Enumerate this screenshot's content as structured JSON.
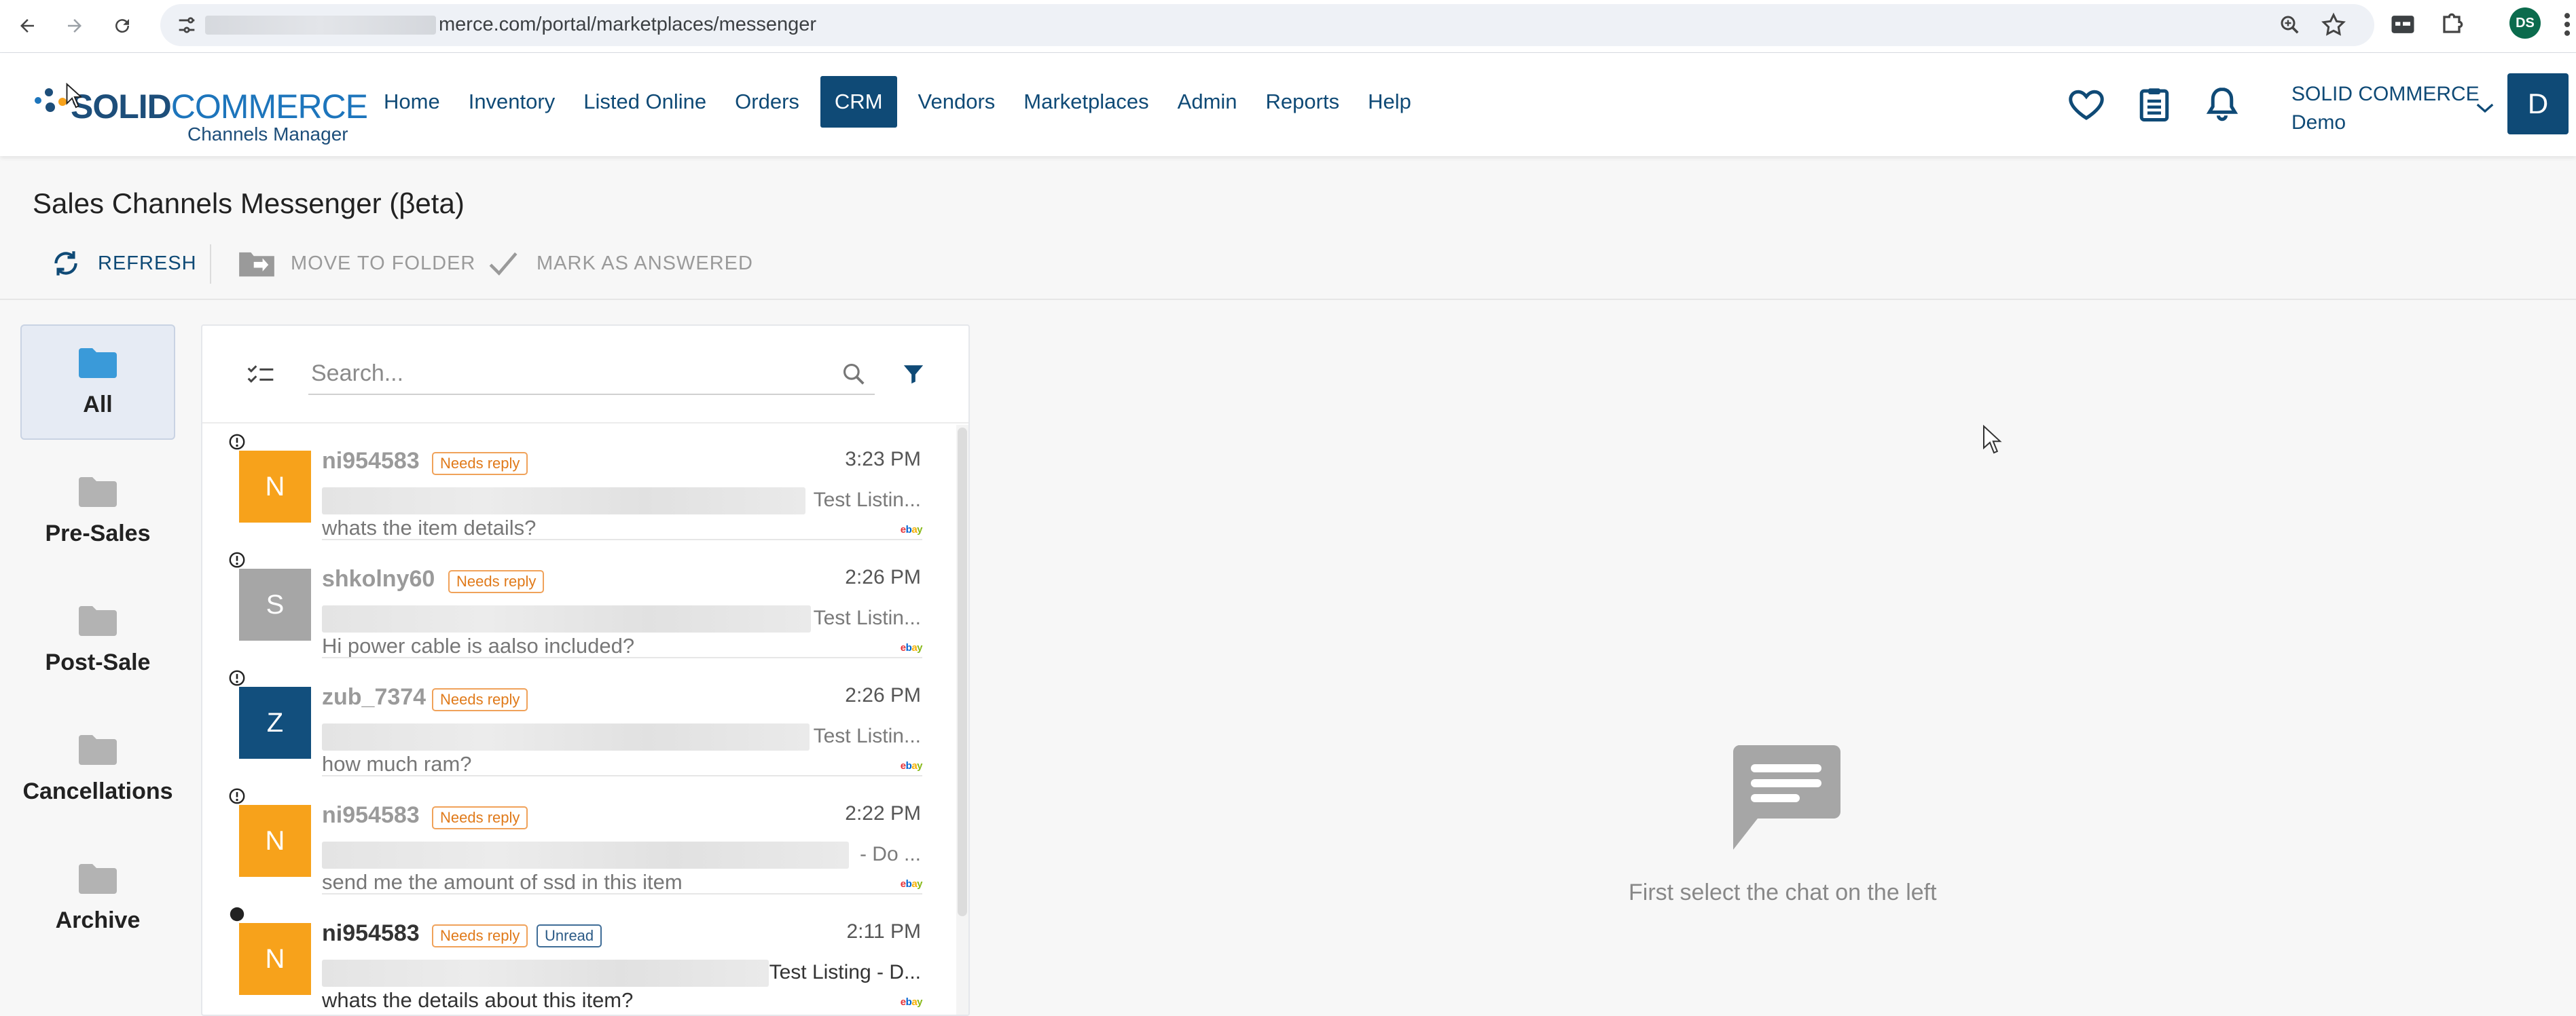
{
  "browser": {
    "url_visible": "merce.com/portal/marketplaces/messenger",
    "profile_initials": "DS"
  },
  "header": {
    "logo": {
      "brand_bold": "SOLID",
      "brand_light": "COMMERCE",
      "subtitle": "Channels Manager"
    },
    "nav": [
      "Home",
      "Inventory",
      "Listed Online",
      "Orders",
      "CRM",
      "Vendors",
      "Marketplaces",
      "Admin",
      "Reports",
      "Help"
    ],
    "active_nav": "CRM",
    "account": {
      "company": "SOLID COMMERCE",
      "user": "Demo"
    },
    "avatar_letter": "D"
  },
  "page": {
    "title": "Sales Channels Messenger (βeta)",
    "toolbar": {
      "refresh": "REFRESH",
      "move_to_folder": "MOVE TO FOLDER",
      "mark_as_answered": "MARK AS ANSWERED"
    }
  },
  "folders": [
    "All",
    "Pre-Sales",
    "Post-Sale",
    "Cancellations",
    "Archive"
  ],
  "active_folder": "All",
  "search": {
    "placeholder": "Search..."
  },
  "chats": [
    {
      "avatar": "N",
      "color": "#f7a21b",
      "name": "ni954583",
      "badge": "Needs reply",
      "unread": false,
      "time": "3:23 PM",
      "listing": "Test Listin...",
      "message": "whats the item details?"
    },
    {
      "avatar": "S",
      "color": "#a6a6a6",
      "name": "shkolny60",
      "badge": "Needs reply",
      "unread": false,
      "time": "2:26 PM",
      "listing": "Test Listin...",
      "message": "Hi power cable is aalso included?"
    },
    {
      "avatar": "Z",
      "color": "#124f7d",
      "name": "zub_7374",
      "badge": "Needs reply",
      "unread": false,
      "time": "2:26 PM",
      "listing": "Test Listin...",
      "message": "how much ram?"
    },
    {
      "avatar": "N",
      "color": "#f7a21b",
      "name": "ni954583",
      "badge": "Needs reply",
      "unread": false,
      "time": "2:22 PM",
      "listing": "- Do ...",
      "message": "send me the amount of ssd in this item"
    },
    {
      "avatar": "N",
      "color": "#f7a21b",
      "name": "ni954583",
      "badge": "Needs reply",
      "badge2": "Unread",
      "unread": true,
      "time": "2:11 PM",
      "listing": "Test Listing - D...",
      "message": "whats the details about this item?"
    }
  ],
  "ebay_letters": [
    "e",
    "b",
    "a",
    "y"
  ],
  "empty_state": {
    "text": "First select the chat on the left"
  }
}
